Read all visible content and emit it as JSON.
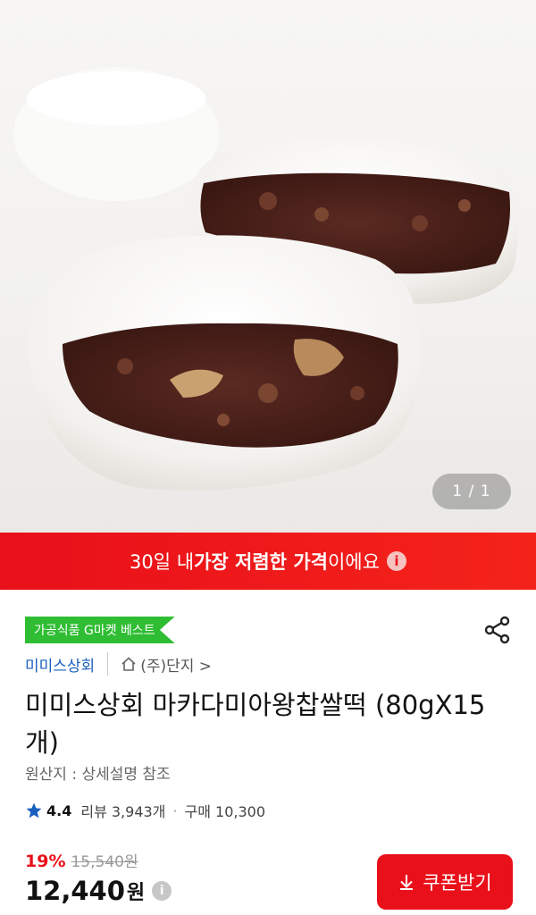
{
  "gallery": {
    "counter": "1 / 1"
  },
  "banner": {
    "prefix": "30일 내 ",
    "highlight": "가장 저렴한 가격",
    "suffix": "이에요",
    "info_icon": "i"
  },
  "badge": {
    "label": "가공식품 G마켓 베스트",
    "color": "#2fbd33"
  },
  "seller": {
    "name": "미미스상회",
    "store": "(주)단지 >"
  },
  "product": {
    "title": "미미스상회 마카다미아왕찹쌀떡 (80gX15개)",
    "origin": "원산지 : 상세설명 참조"
  },
  "rating": {
    "score": "4.4",
    "reviews": "리뷰 3,943개",
    "dot": "·",
    "purchases": "구매 10,300"
  },
  "price": {
    "discount": "19%",
    "original": "15,540원",
    "current": "12,440",
    "currency": "원",
    "info_icon": "i"
  },
  "coupon": {
    "label": "쿠폰받기"
  },
  "colors": {
    "accent": "#e9101a",
    "seller": "#1a5fbf",
    "star": "#1a5fbf"
  },
  "icons": {
    "share": "share-icon",
    "home": "home-icon",
    "star": "star-icon",
    "download": "download-icon"
  }
}
